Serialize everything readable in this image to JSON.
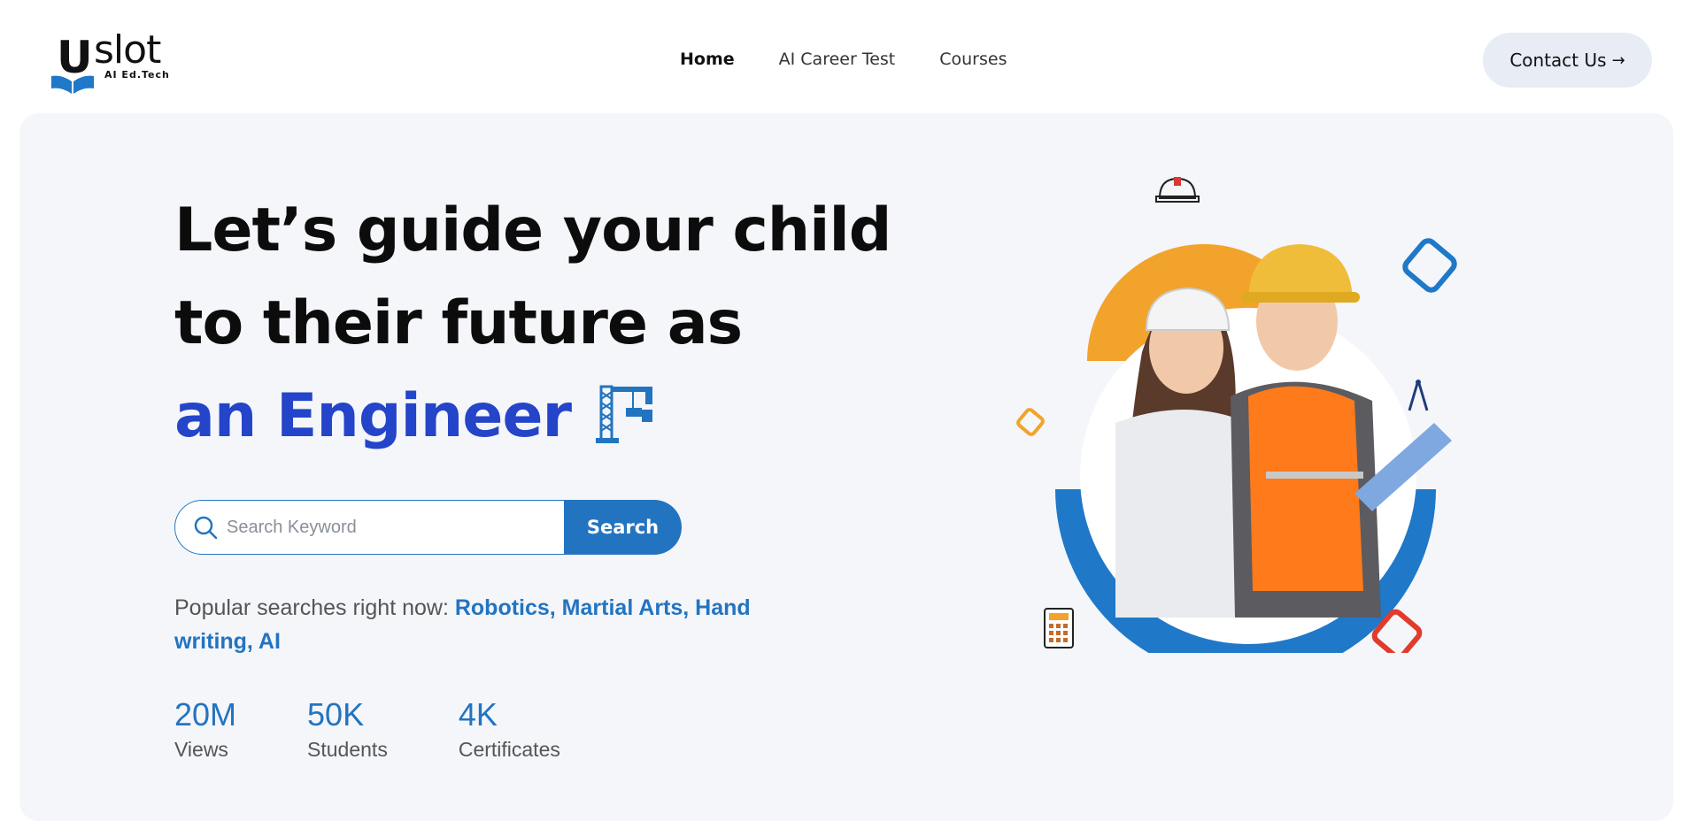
{
  "logo": {
    "letter": "U",
    "word": "slot",
    "tagline": "AI Ed.Tech"
  },
  "nav": {
    "items": [
      {
        "label": "Home",
        "active": true
      },
      {
        "label": "AI Career Test",
        "active": false
      },
      {
        "label": "Courses",
        "active": false
      }
    ]
  },
  "header": {
    "contact_label": "Contact Us",
    "contact_icon": "arrow-right-icon"
  },
  "hero": {
    "line1": "Let’s guide your child",
    "line2": "to their future as",
    "line3": "an Engineer",
    "headline_icon": "crane-icon"
  },
  "search": {
    "placeholder": "Search Keyword",
    "button_label": "Search"
  },
  "popular": {
    "prefix": "Popular searches right now: ",
    "links": "Robotics, Martial Arts, Hand writing, AI"
  },
  "stats": [
    {
      "value": "20M",
      "label": "Views"
    },
    {
      "value": "50K",
      "label": "Students"
    },
    {
      "value": "4K",
      "label": "Certificates"
    }
  ],
  "colors": {
    "accent_blue": "#2374c0",
    "headline_blue": "#2444c9",
    "orange": "#f2a32b",
    "hero_bg": "#f4f6fa"
  }
}
